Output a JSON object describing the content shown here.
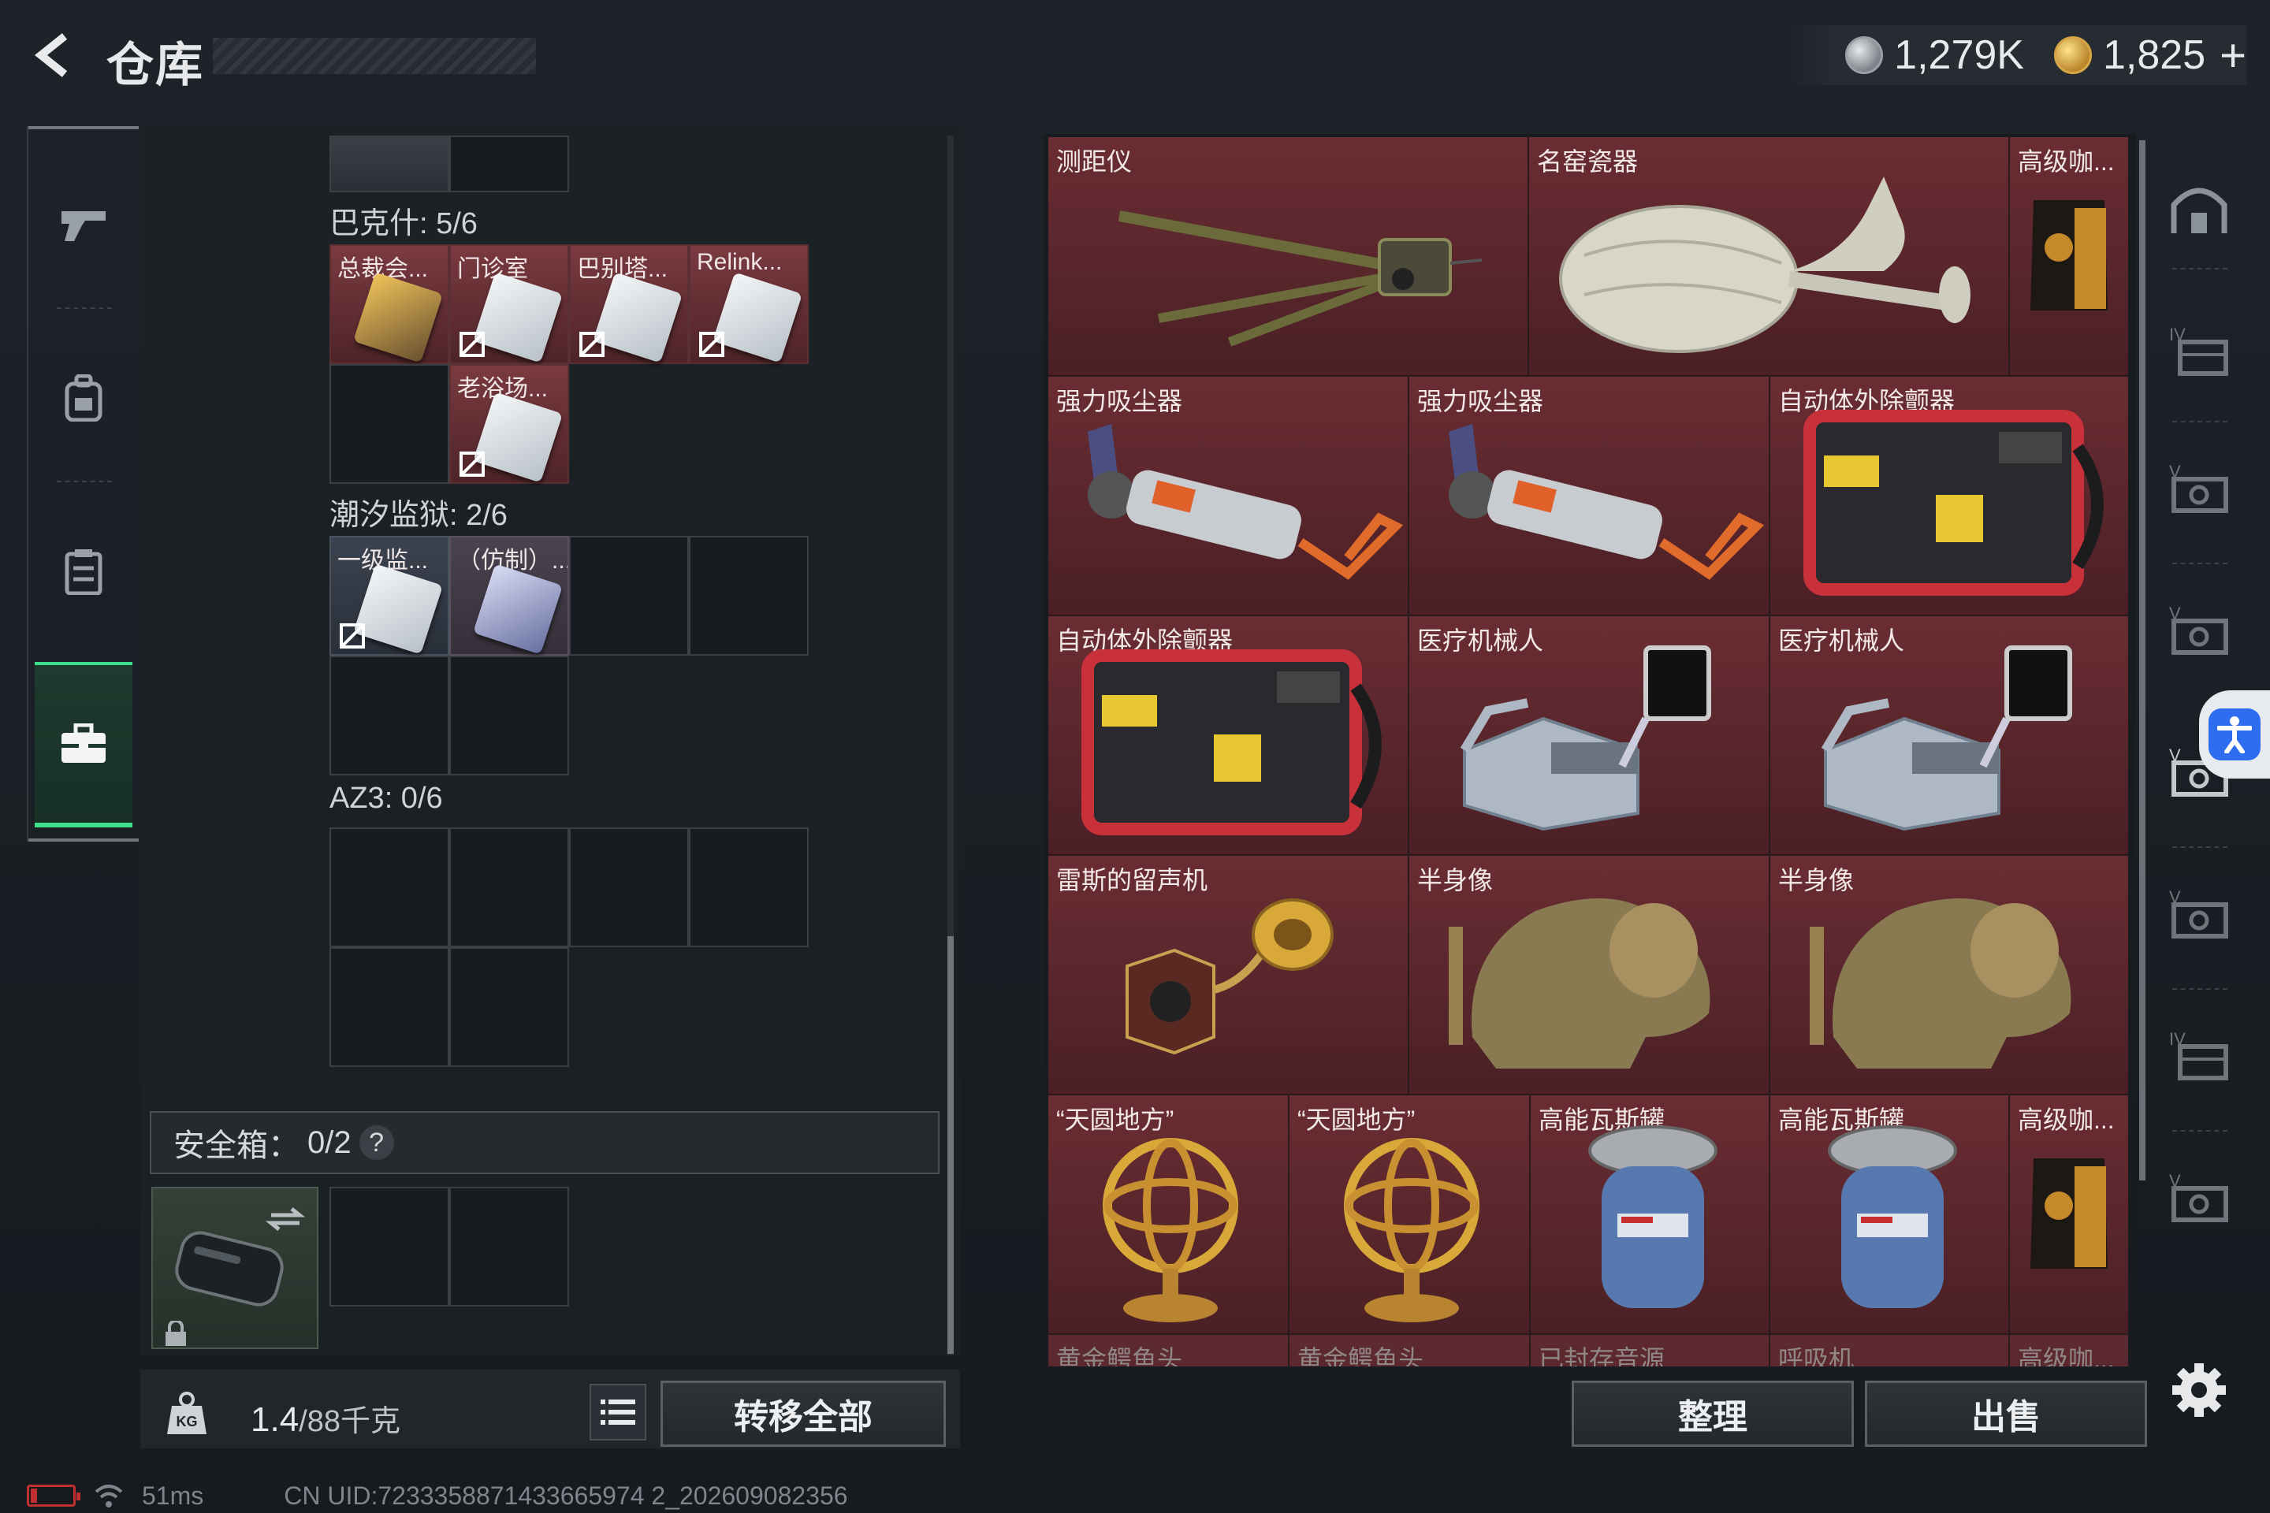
{
  "header": {
    "title": "仓库",
    "currencies": [
      {
        "icon": "silver-coin-icon",
        "value": "1,279K"
      },
      {
        "icon": "gold-coin-icon",
        "value": "1,825"
      }
    ],
    "add_label": "+"
  },
  "left_nav": [
    {
      "icon": "pistol-icon",
      "active": false
    },
    {
      "icon": "backpack-icon",
      "active": false
    },
    {
      "icon": "vest-icon",
      "active": false
    },
    {
      "icon": "briefcase-icon",
      "active": true
    }
  ],
  "containers": [
    {
      "title": "巴克什: 5/6",
      "items": [
        {
          "label": "总裁会...",
          "style": "gold"
        },
        {
          "label": "门诊室",
          "style": "white"
        },
        {
          "label": "巴别塔...",
          "style": "white"
        },
        {
          "label": "Relink...",
          "style": "white"
        },
        {
          "label": "老浴场...",
          "style": "white"
        }
      ]
    },
    {
      "title": "潮汐监狱: 2/6",
      "items": [
        {
          "label": "一级监...",
          "style": "white"
        },
        {
          "label": "（仿制）...",
          "style": "blue"
        }
      ]
    },
    {
      "title": "AZ3: 0/6",
      "items": []
    }
  ],
  "safe_box": {
    "label": "安全箱：",
    "count": "0/2",
    "help": "?"
  },
  "bottom_left": {
    "weight_icon_text": "KG",
    "weight_value": "1.4",
    "weight_limit": "/88千克",
    "transfer_label": "转移全部"
  },
  "status_bar": {
    "ping": "51ms",
    "uid": "CN UID:7233358871433665974 2_202609082356"
  },
  "stash_items": [
    {
      "label": "测距仪",
      "icon": "rangefinder-icon"
    },
    {
      "label": "名窑瓷器",
      "icon": "porcelain-vase-icon"
    },
    {
      "label": "高级咖...",
      "icon": "coffee-bag-icon"
    },
    {
      "label": "强力吸尘器",
      "icon": "vacuum-cleaner-icon"
    },
    {
      "label": "强力吸尘器",
      "icon": "vacuum-cleaner-icon"
    },
    {
      "label": "自动体外除颤器",
      "icon": "aed-icon"
    },
    {
      "label": "自动体外除颤器",
      "icon": "aed-icon"
    },
    {
      "label": "医疗机械人",
      "icon": "medical-robot-icon"
    },
    {
      "label": "医疗机械人",
      "icon": "medical-robot-icon"
    },
    {
      "label": "雷斯的留声机",
      "icon": "gramophone-icon"
    },
    {
      "label": "半身像",
      "icon": "bust-icon"
    },
    {
      "label": "半身像",
      "icon": "bust-icon"
    },
    {
      "label": "“天圆地方”",
      "icon": "armillary-sphere-icon"
    },
    {
      "label": "“天圆地方”",
      "icon": "armillary-sphere-icon"
    },
    {
      "label": "高能瓦斯罐",
      "icon": "gas-tank-icon"
    },
    {
      "label": "高能瓦斯罐",
      "icon": "gas-tank-icon"
    },
    {
      "label": "高级咖...",
      "icon": "coffee-bag-icon"
    },
    {
      "label": "黄金鳄鱼头",
      "icon": "item-icon"
    },
    {
      "label": "黄金鳄鱼头",
      "icon": "item-icon"
    },
    {
      "label": "已封存音源",
      "icon": "item-icon"
    },
    {
      "label": "呼吸机",
      "icon": "item-icon"
    },
    {
      "label": "高级咖...",
      "icon": "item-icon"
    }
  ],
  "actions": {
    "tidy_label": "整理",
    "sell_label": "出售"
  },
  "right_nav": [
    "home-icon",
    "tier-4-box-icon",
    "tier-5-box-icon",
    "tier-5-box-icon",
    "tier-5-box-icon",
    "tier-5-box-icon",
    "tier-4-box-icon",
    "tier-5-box-icon"
  ],
  "colors": {
    "item_red": "#6a2d33",
    "active_green": "#3fe08b",
    "access_blue": "#2e6cf0"
  }
}
